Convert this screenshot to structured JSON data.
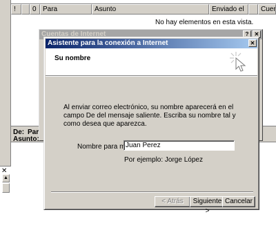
{
  "message_list": {
    "columns": [
      "!",
      "",
      "0",
      "Para",
      "Asunto",
      "Enviado el",
      "",
      "Cuenta"
    ],
    "empty_text": "No hay elementos en esta vista."
  },
  "preview": {
    "to_label": "De:",
    "to_value": "Para",
    "subject_label": "Asunto:"
  },
  "accounts_dialog": {
    "title": "Cuentas de Internet",
    "help_glyph": "?",
    "close_glyph": "✕"
  },
  "wizard": {
    "title": "Asistente para la conexión a Internet",
    "close_glyph": "✕",
    "step_title": "Su nombre",
    "intro": "Al enviar correo electrónico, su nombre aparecerá en el campo De del mensaje saliente. Escriba su nombre tal y como desea que aparezca.",
    "name_label": "Nombre para mostrar:",
    "name_value": "Juan Perez",
    "example": "Por ejemplo: Jorge López",
    "buttons": {
      "back": "< Atrás",
      "next": "Siguiente >",
      "cancel": "Cancelar"
    }
  },
  "lower_pane": {
    "close_glyph": "✕",
    "scroll_up_glyph": "▲"
  }
}
